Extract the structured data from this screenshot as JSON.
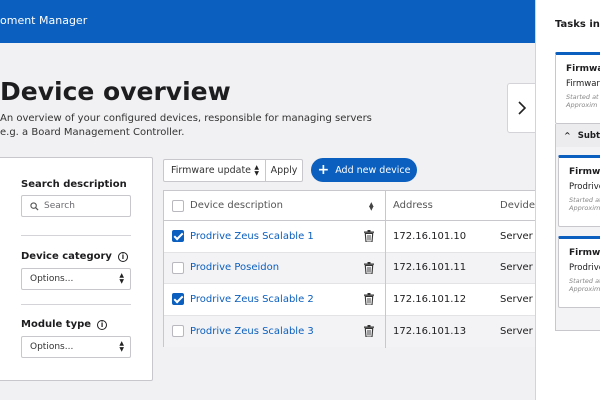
{
  "header": {
    "app_title": "oment Manager"
  },
  "page": {
    "title": "Device overview",
    "subtitle": "An overview of your configured devices, responsible for managing servers e.g. a Board Management Controller."
  },
  "filters": {
    "search_label": "Search description",
    "search_placeholder": "Search",
    "category_label": "Device category",
    "category_value": "Options...",
    "module_label": "Module type",
    "module_value": "Options...",
    "info_glyph": "i"
  },
  "toolbar": {
    "bulk_action_value": "Firmware update",
    "apply_label": "Apply",
    "add_label": "Add new device"
  },
  "table": {
    "columns": [
      "Device description",
      "Address",
      "Devide"
    ],
    "rows": [
      {
        "description": "Prodrive Zeus Scalable 1",
        "address": "172.16.101.10",
        "type": "Server",
        "checked": true
      },
      {
        "description": "Prodrive Poseidon",
        "address": "172.16.101.11",
        "type": "Server",
        "checked": false
      },
      {
        "description": "Prodrive Zeus Scalable 2",
        "address": "172.16.101.12",
        "type": "Server",
        "checked": true
      },
      {
        "description": "Prodrive Zeus Scalable 3",
        "address": "172.16.101.13",
        "type": "Server",
        "checked": false
      }
    ]
  },
  "tasks": {
    "title": "Tasks in p",
    "cards": [
      {
        "title": "Firmwa",
        "subtitle": "Firmware",
        "meta1": "Started at",
        "meta2": "Approxim"
      },
      {
        "title": "Firmwa",
        "subtitle": "Prodrive",
        "meta1": "Started at",
        "meta2": "Approxim"
      },
      {
        "title": "Firmwa",
        "subtitle": "Prodrive",
        "meta1": "Started at",
        "meta2": "Approxim"
      }
    ],
    "subtasks_label": "Subtas"
  },
  "colors": {
    "brand": "#0b5fbe",
    "background": "#f1f1f3"
  }
}
